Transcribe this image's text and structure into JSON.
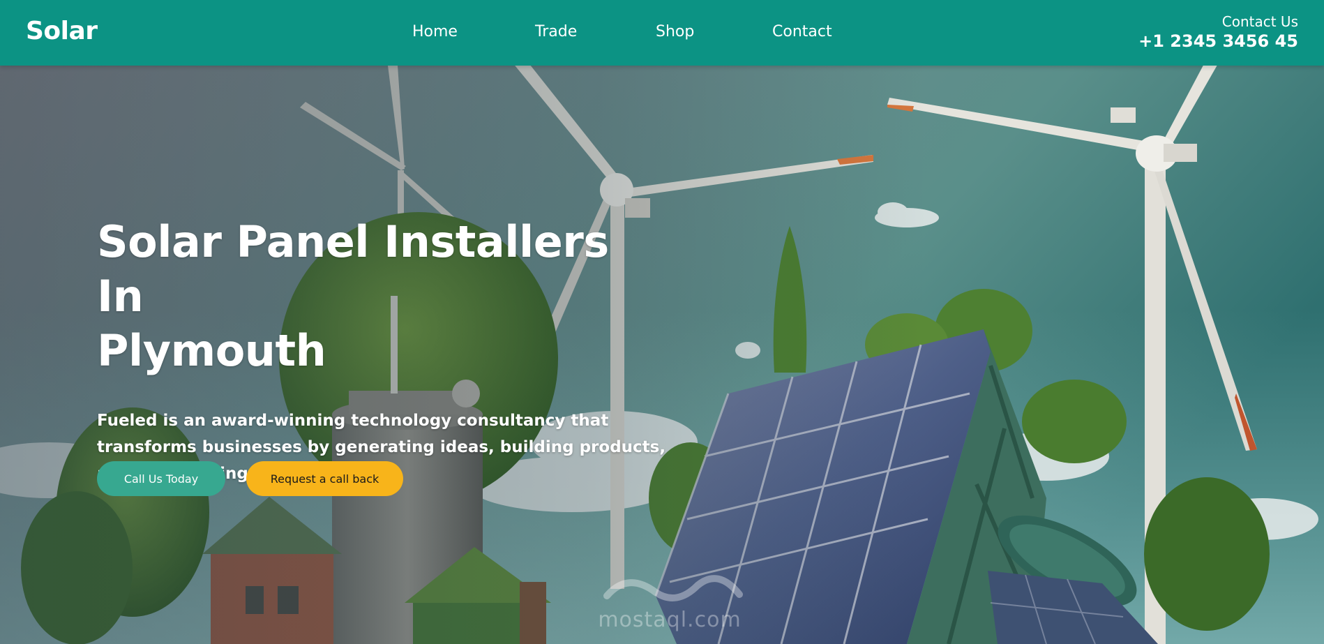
{
  "header": {
    "logo": "Solar",
    "nav": [
      {
        "label": "Home"
      },
      {
        "label": "Trade"
      },
      {
        "label": "Shop"
      },
      {
        "label": "Contact"
      }
    ],
    "contact_label": "Contact Us",
    "contact_phone": "+1 2345 3456 45"
  },
  "hero": {
    "title_line1": "Solar Panel Installers In",
    "title_line2": "Plymouth",
    "description": "Fueled is an award-winning technology consultancy that transforms businesses by generating ideas, building products, and accelerating growth.",
    "cta_primary": "Call Us Today",
    "cta_secondary": "Request a call back",
    "watermark": "mostaql.com"
  },
  "colors": {
    "header_bg": "#0c9384",
    "primary_button": "#37a890",
    "secondary_button": "#f8b41a",
    "text_light": "#ffffff"
  }
}
